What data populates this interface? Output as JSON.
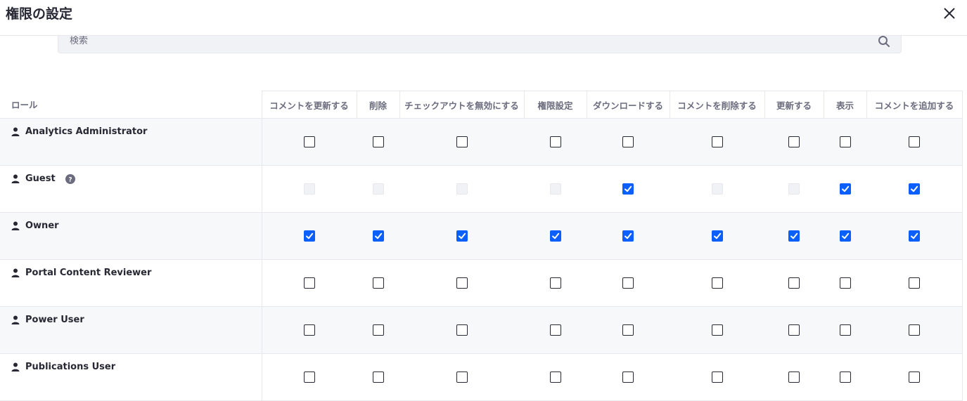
{
  "modal": {
    "title": "権限の設定"
  },
  "search": {
    "placeholder": "検索",
    "value": ""
  },
  "icons": {
    "close": "close-icon",
    "search": "search-icon",
    "user": "user-icon",
    "help": "question-circle-icon",
    "check": "check-icon"
  },
  "colors": {
    "accent": "#0b5fff",
    "text": "#272833",
    "muted": "#6b6c7e",
    "border": "#e7e7ed",
    "row_alt": "#f7f8f9"
  },
  "table": {
    "role_header": "ロール",
    "columns": [
      "コメントを更新する",
      "削除",
      "チェックアウトを無効にする",
      "権限設定",
      "ダウンロードする",
      "コメントを削除する",
      "更新する",
      "表示",
      "コメントを追加する"
    ],
    "rows": [
      {
        "role": "Analytics Administrator",
        "help": false,
        "perms": [
          "unchecked",
          "unchecked",
          "unchecked",
          "unchecked",
          "unchecked",
          "unchecked",
          "unchecked",
          "unchecked",
          "unchecked"
        ]
      },
      {
        "role": "Guest",
        "help": true,
        "perms": [
          "disabled",
          "disabled",
          "disabled",
          "disabled",
          "checked",
          "disabled",
          "disabled",
          "checked",
          "checked"
        ]
      },
      {
        "role": "Owner",
        "help": false,
        "perms": [
          "checked",
          "checked",
          "checked",
          "checked",
          "checked",
          "checked",
          "checked",
          "checked",
          "checked"
        ]
      },
      {
        "role": "Portal Content Reviewer",
        "help": false,
        "perms": [
          "unchecked",
          "unchecked",
          "unchecked",
          "unchecked",
          "unchecked",
          "unchecked",
          "unchecked",
          "unchecked",
          "unchecked"
        ]
      },
      {
        "role": "Power User",
        "help": false,
        "perms": [
          "unchecked",
          "unchecked",
          "unchecked",
          "unchecked",
          "unchecked",
          "unchecked",
          "unchecked",
          "unchecked",
          "unchecked"
        ]
      },
      {
        "role": "Publications User",
        "help": false,
        "perms": [
          "unchecked",
          "unchecked",
          "unchecked",
          "unchecked",
          "unchecked",
          "unchecked",
          "unchecked",
          "unchecked",
          "unchecked"
        ]
      }
    ]
  }
}
